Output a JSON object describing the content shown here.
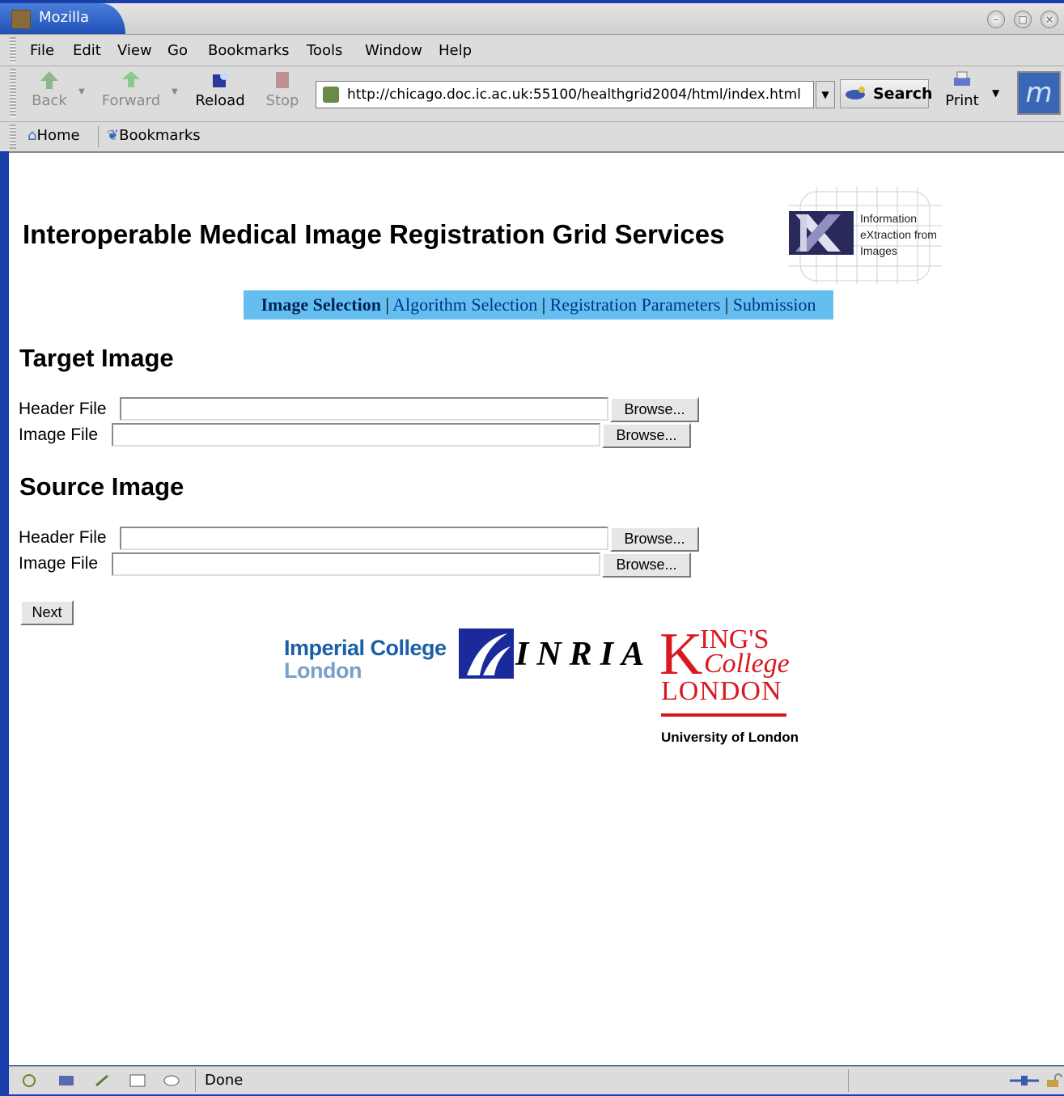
{
  "window": {
    "title": "Mozilla"
  },
  "menu": [
    "File",
    "Edit",
    "View",
    "Go",
    "Bookmarks",
    "Tools",
    "Window",
    "Help"
  ],
  "toolbar": {
    "back": "Back",
    "forward": "Forward",
    "reload": "Reload",
    "stop": "Stop",
    "url": "http://chicago.doc.ic.ac.uk:55100/healthgrid2004/html/index.html",
    "search": "Search",
    "print": "Print"
  },
  "personal": {
    "home": "Home",
    "bookmarks": "Bookmarks"
  },
  "page": {
    "title": "Interoperable Medical Image Registration Grid Services",
    "logo_text": [
      "Information",
      "eXtraction from",
      "Images"
    ],
    "nav": {
      "current": "Image Selection",
      "items": [
        "Algorithm Selection",
        "Registration Parameters",
        "Submission"
      ],
      "separator": "|"
    },
    "target": {
      "heading": "Target Image",
      "header_label": "Header File",
      "image_label": "Image File",
      "browse": "Browse..."
    },
    "source": {
      "heading": "Source Image",
      "header_label": "Header File",
      "image_label": "Image File",
      "browse": "Browse..."
    },
    "next": "Next",
    "logos": {
      "imperial": [
        "Imperial College",
        "London"
      ],
      "inria": "INRIA",
      "kings": {
        "k": "K",
        "ings": "ING'S",
        "college": "College",
        "london": "LONDON",
        "uol": "University of London"
      }
    }
  },
  "status": {
    "text": "Done"
  }
}
